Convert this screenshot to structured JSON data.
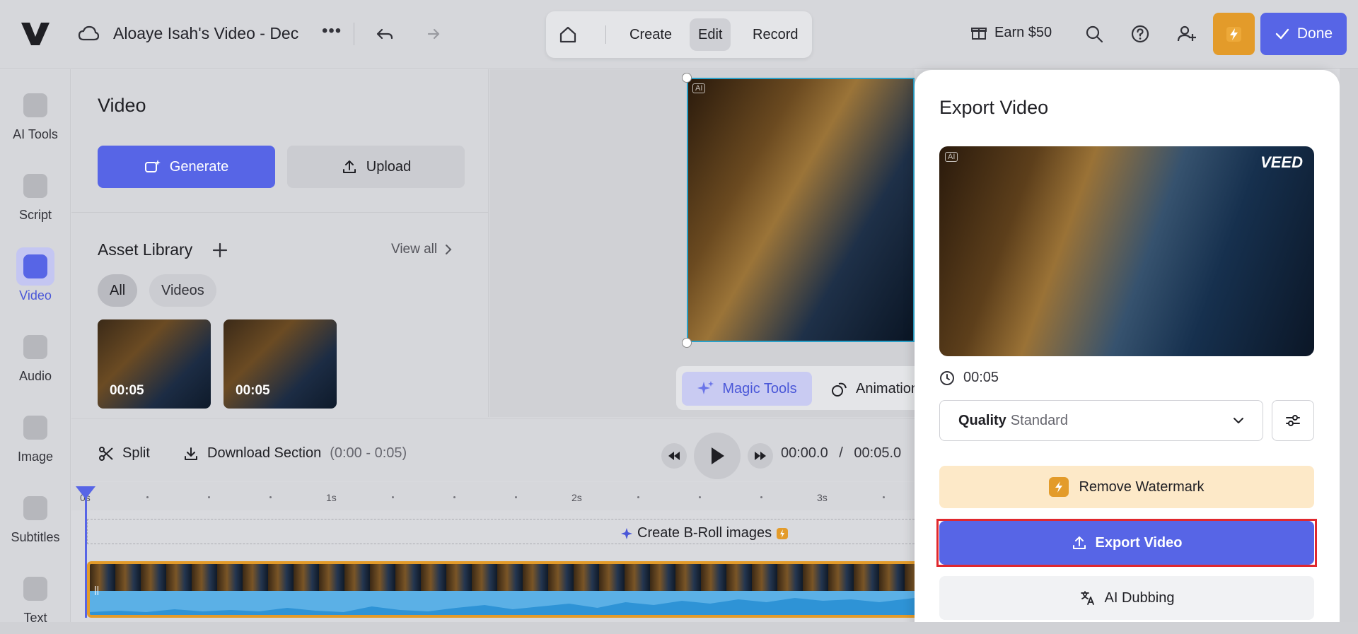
{
  "header": {
    "project_title": "Aloaye Isah's Video - Dec",
    "more": "•••",
    "modes": [
      "Create",
      "Edit",
      "Record"
    ],
    "active_mode": "Edit",
    "earn_label": "Earn $50",
    "done_label": "Done"
  },
  "rail": {
    "items": [
      {
        "label": "AI Tools",
        "icon": "sparkle-icon"
      },
      {
        "label": "Script",
        "icon": "script-icon"
      },
      {
        "label": "Video",
        "icon": "video-camera-icon"
      },
      {
        "label": "Audio",
        "icon": "music-note-icon"
      },
      {
        "label": "Image",
        "icon": "image-icon"
      },
      {
        "label": "Subtitles",
        "icon": "subtitles-icon"
      },
      {
        "label": "Text",
        "icon": "text-icon"
      }
    ],
    "active": "Video"
  },
  "panel": {
    "title": "Video",
    "generate_label": "Generate",
    "upload_label": "Upload",
    "asset_library_title": "Asset Library",
    "view_all_label": "View all",
    "filters": [
      "All",
      "Videos"
    ],
    "active_filter": "All",
    "assets": [
      {
        "duration": "00:05"
      },
      {
        "duration": "00:05"
      }
    ]
  },
  "stage": {
    "ai_badge": "AI",
    "magic_tools_label": "Magic Tools",
    "animation_label": "Animation"
  },
  "timeline": {
    "split_label": "Split",
    "download_label": "Download Section",
    "download_range": "(0:00 - 0:05)",
    "current_time": "00:00.0",
    "separator": "/",
    "total_time": "00:05.0",
    "ruler_ticks": [
      "0s",
      "1s",
      "2s",
      "3s"
    ],
    "broll_label": "Create B-Roll images"
  },
  "export_modal": {
    "title": "Export Video",
    "watermark_brand": "VEED",
    "ai_badge": "AI",
    "duration": "00:05",
    "quality_label": "Quality",
    "quality_value": "Standard",
    "remove_watermark_label": "Remove Watermark",
    "export_label": "Export Video",
    "dubbing_label": "AI Dubbing"
  },
  "colors": {
    "accent": "#5765e6",
    "upgrade": "#e39b2a",
    "highlight_ring": "#e0282e",
    "watermark_bg": "#fde9c8"
  }
}
